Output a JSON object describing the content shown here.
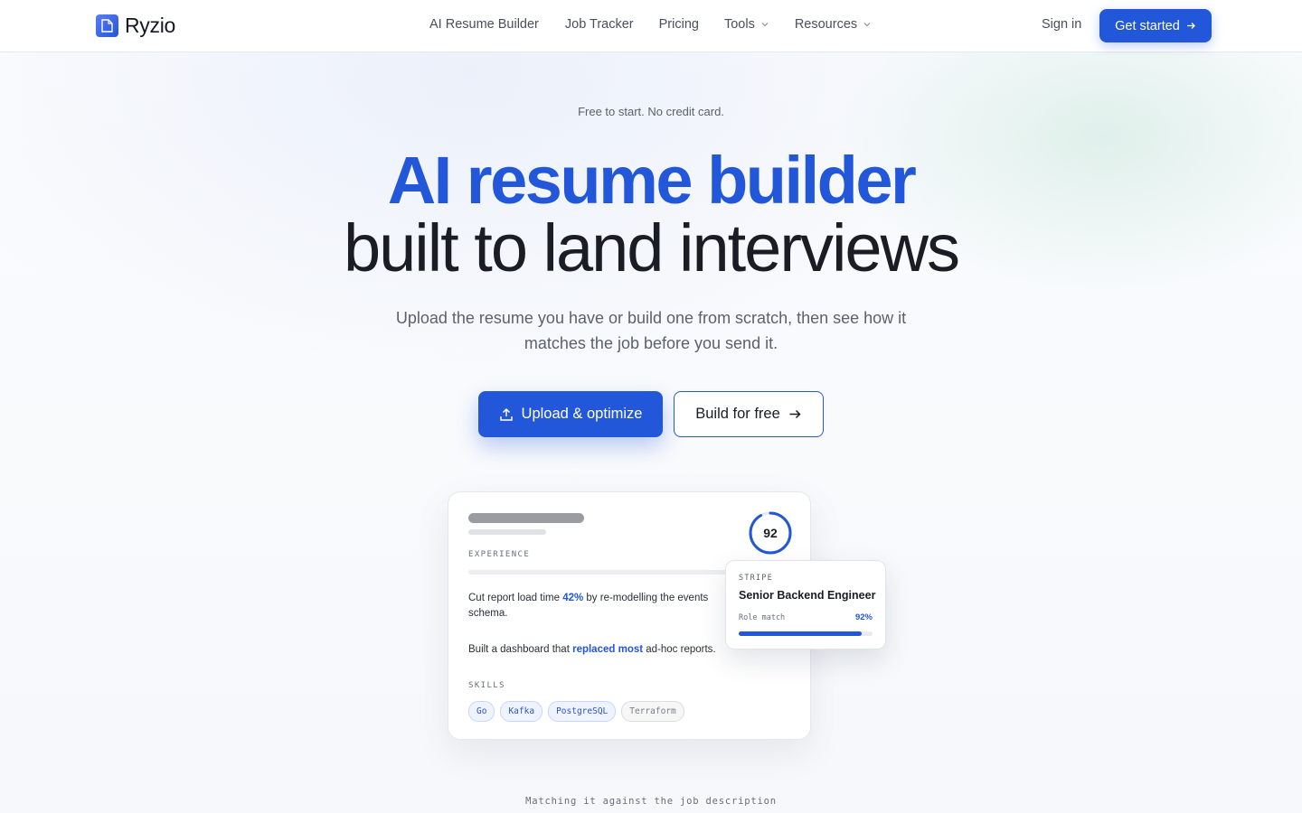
{
  "brand": {
    "name": "Ryzio",
    "accent": "#2257d9"
  },
  "nav": {
    "items": [
      {
        "label": "AI Resume Builder",
        "has_dropdown": false
      },
      {
        "label": "Job Tracker",
        "has_dropdown": false
      },
      {
        "label": "Pricing",
        "has_dropdown": false
      },
      {
        "label": "Tools",
        "has_dropdown": true
      },
      {
        "label": "Resources",
        "has_dropdown": true
      }
    ],
    "sign_in": "Sign in",
    "cta": "Get started"
  },
  "hero": {
    "eyebrow": "Free to start. No credit card.",
    "headline_line1": "AI resume builder",
    "headline_line2": "built to land interviews",
    "subtitle": "Upload the resume you have or build one from scratch, then see how it matches the job before you send it.",
    "primary_button": "Upload & optimize",
    "secondary_button": "Build for free"
  },
  "preview": {
    "score": "92",
    "score_fraction": 0.92,
    "experience_label": "EXPERIENCE",
    "bullet1": {
      "pre": "Cut report load time ",
      "highlight": "42%",
      "post": " by re-modelling the events schema."
    },
    "bullet2": {
      "pre": "Built a dashboard that ",
      "highlight": "replaced most",
      "post": " ad-hoc reports."
    },
    "skills_label": "SKILLS",
    "skills": [
      {
        "label": "Go",
        "matched": true
      },
      {
        "label": "Kafka",
        "matched": true
      },
      {
        "label": "PostgreSQL",
        "matched": true
      },
      {
        "label": "Terraform",
        "matched": false
      }
    ]
  },
  "job_card": {
    "company": "STRIPE",
    "title": "Senior Backend Engineer",
    "match_label": "Role match",
    "match_value": "92%",
    "match_fraction": 0.92
  },
  "caption": "Matching it against the job description",
  "icons": [
    "logo-document-icon",
    "chevron-down-icon",
    "arrow-right-icon",
    "upload-icon"
  ]
}
